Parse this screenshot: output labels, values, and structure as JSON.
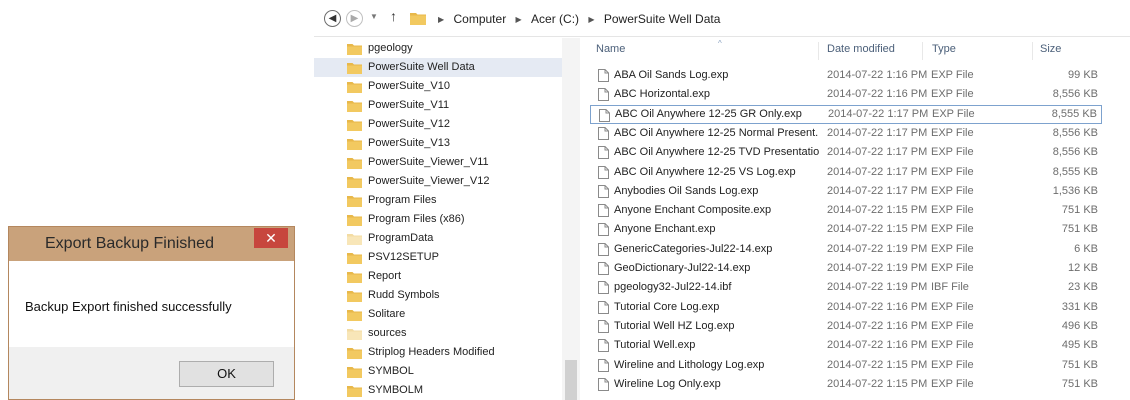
{
  "dialog": {
    "title": "Export Backup Finished",
    "close_glyph": "✕",
    "message": "Backup Export finished successfully",
    "ok_label": "OK"
  },
  "address": {
    "back_glyph": "◀",
    "forward_glyph": "▶",
    "recent_glyph": "▼",
    "up_glyph": "↑",
    "crumbs": [
      "Computer",
      "Acer (C:)",
      "PowerSuite Well Data"
    ]
  },
  "tree": {
    "items": [
      {
        "label": "pgeology"
      },
      {
        "label": "PowerSuite Well Data",
        "selected": true
      },
      {
        "label": "PowerSuite_V10"
      },
      {
        "label": "PowerSuite_V11"
      },
      {
        "label": "PowerSuite_V12"
      },
      {
        "label": "PowerSuite_V13"
      },
      {
        "label": "PowerSuite_Viewer_V11"
      },
      {
        "label": "PowerSuite_Viewer_V12"
      },
      {
        "label": "Program Files"
      },
      {
        "label": "Program Files (x86)"
      },
      {
        "label": "ProgramData"
      },
      {
        "label": "PSV12SETUP"
      },
      {
        "label": "Report"
      },
      {
        "label": "Rudd Symbols"
      },
      {
        "label": "Solitare"
      },
      {
        "label": "sources"
      },
      {
        "label": "Striplog Headers Modified"
      },
      {
        "label": "SYMBOL"
      },
      {
        "label": "SYMBOLM"
      }
    ]
  },
  "filelist": {
    "columns": {
      "name": "Name",
      "date": "Date modified",
      "type": "Type",
      "size": "Size"
    },
    "files": [
      {
        "name": "ABA Oil Sands Log.exp",
        "date": "2014-07-22 1:16 PM",
        "type": "EXP File",
        "size": "99 KB"
      },
      {
        "name": "ABC Horizontal.exp",
        "date": "2014-07-22 1:16 PM",
        "type": "EXP File",
        "size": "8,556 KB"
      },
      {
        "name": "ABC Oil Anywhere 12-25 GR Only.exp",
        "date": "2014-07-22 1:17 PM",
        "type": "EXP File",
        "size": "8,555 KB",
        "selected": true
      },
      {
        "name": "ABC Oil Anywhere 12-25 Normal Present...",
        "date": "2014-07-22 1:17 PM",
        "type": "EXP File",
        "size": "8,556 KB"
      },
      {
        "name": "ABC Oil Anywhere 12-25 TVD Presentatio...",
        "date": "2014-07-22 1:17 PM",
        "type": "EXP File",
        "size": "8,556 KB"
      },
      {
        "name": "ABC Oil Anywhere 12-25 VS Log.exp",
        "date": "2014-07-22 1:17 PM",
        "type": "EXP File",
        "size": "8,555 KB"
      },
      {
        "name": "Anybodies Oil Sands Log.exp",
        "date": "2014-07-22 1:17 PM",
        "type": "EXP File",
        "size": "1,536 KB"
      },
      {
        "name": "Anyone Enchant Composite.exp",
        "date": "2014-07-22 1:15 PM",
        "type": "EXP File",
        "size": "751 KB"
      },
      {
        "name": "Anyone Enchant.exp",
        "date": "2014-07-22 1:15 PM",
        "type": "EXP File",
        "size": "751 KB"
      },
      {
        "name": "GenericCategories-Jul22-14.exp",
        "date": "2014-07-22 1:19 PM",
        "type": "EXP File",
        "size": "6 KB"
      },
      {
        "name": "GeoDictionary-Jul22-14.exp",
        "date": "2014-07-22 1:19 PM",
        "type": "EXP File",
        "size": "12 KB"
      },
      {
        "name": "pgeology32-Jul22-14.ibf",
        "date": "2014-07-22 1:19 PM",
        "type": "IBF File",
        "size": "23 KB"
      },
      {
        "name": "Tutorial Core Log.exp",
        "date": "2014-07-22 1:16 PM",
        "type": "EXP File",
        "size": "331 KB"
      },
      {
        "name": "Tutorial Well HZ Log.exp",
        "date": "2014-07-22 1:16 PM",
        "type": "EXP File",
        "size": "496 KB"
      },
      {
        "name": "Tutorial Well.exp",
        "date": "2014-07-22 1:16 PM",
        "type": "EXP File",
        "size": "495 KB"
      },
      {
        "name": "Wireline and Lithology Log.exp",
        "date": "2014-07-22 1:15 PM",
        "type": "EXP File",
        "size": "751 KB"
      },
      {
        "name": "Wireline Log Only.exp",
        "date": "2014-07-22 1:15 PM",
        "type": "EXP File",
        "size": "751 KB"
      }
    ]
  },
  "colors": {
    "dialog_titlebar": "#c9a27b",
    "close_button": "#c7463d",
    "folder": "#e8b84a",
    "selection": "#e5eaf3",
    "selection_border": "#7da2ce"
  }
}
